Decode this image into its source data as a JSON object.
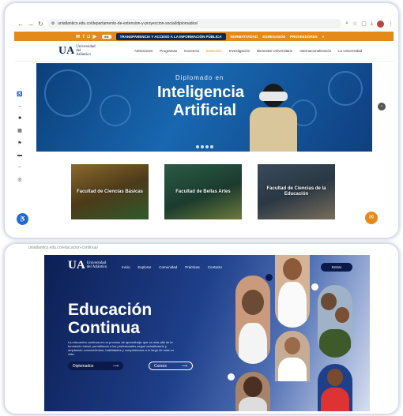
{
  "browser": {
    "url": "uniatlantico.edu.co/departamento-de-extension-y-proyeccion-social/diplomados/",
    "url2": "uniatlantico.edu.co/educacion-continua/"
  },
  "topbar": {
    "items": [
      "TRANSPARENCIA Y ACCESO A LA INFORMACIÓN PÚBLICA",
      "NORMATIVIDAD",
      "EGRESADOS",
      "PROVEEDORES"
    ]
  },
  "logo": {
    "mark": "UA",
    "line1": "Universidad",
    "line2": "del Atlántico"
  },
  "nav": {
    "items": [
      "Admisiones",
      "Programas",
      "Docencia",
      "Extensión",
      "Investigación",
      "Bienestar Universitario",
      "Internacionalización",
      "La Universidad"
    ],
    "active": "Extensión"
  },
  "hero": {
    "line1": "Diplomado en",
    "line2": "Inteligencia",
    "line3": "Artificial"
  },
  "faculties": [
    {
      "label": "Facultad de Ciencias Básicas"
    },
    {
      "label": "Facultad de Bellas Artes"
    },
    {
      "label": "Facultad de Ciencias de la Educación"
    }
  ],
  "continua": {
    "menu": [
      "Inicio",
      "Explorar",
      "Comunidad",
      "Prácticas",
      "Contacto"
    ],
    "enter": "Entrar",
    "title1": "Educación",
    "title2": "Continua",
    "description": "La educación continua es un proceso de aprendizaje que va más allá de la formación inicial, permitiendo a los profesionales seguir actualizando y ampliando conocimientos, habilidades y competencias a lo largo de toda su vida.",
    "btn_diplomados": "Diplomados",
    "btn_cursos": "Cursos"
  },
  "colors": {
    "accent": "#e48a1b",
    "navy": "#0b2a5b",
    "blue": "#1867b0"
  }
}
